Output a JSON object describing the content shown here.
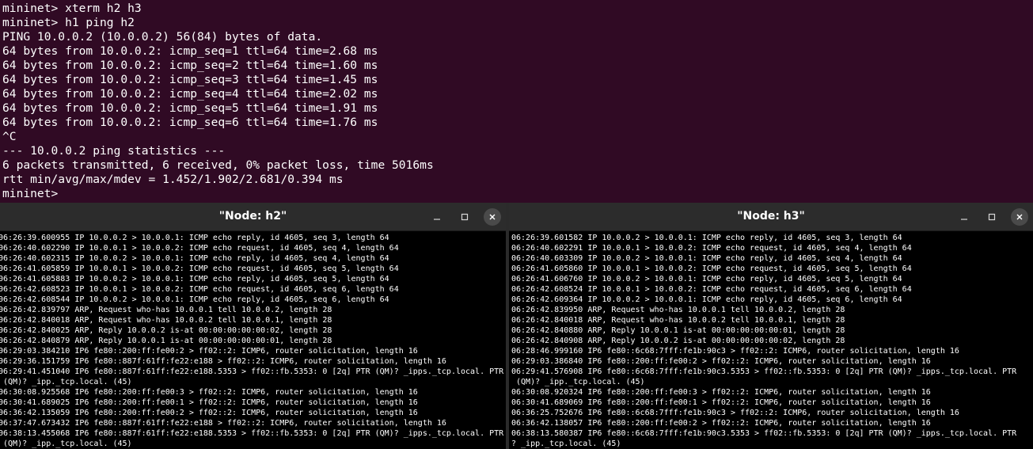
{
  "main_terminal": {
    "lines": [
      "mininet> xterm h2 h3",
      "mininet> h1 ping h2",
      "PING 10.0.0.2 (10.0.0.2) 56(84) bytes of data.",
      "64 bytes from 10.0.0.2: icmp_seq=1 ttl=64 time=2.68 ms",
      "64 bytes from 10.0.0.2: icmp_seq=2 ttl=64 time=1.60 ms",
      "64 bytes from 10.0.0.2: icmp_seq=3 ttl=64 time=1.45 ms",
      "64 bytes from 10.0.0.2: icmp_seq=4 ttl=64 time=2.02 ms",
      "64 bytes from 10.0.0.2: icmp_seq=5 ttl=64 time=1.91 ms",
      "64 bytes from 10.0.0.2: icmp_seq=6 ttl=64 time=1.76 ms",
      "^C",
      "--- 10.0.0.2 ping statistics ---",
      "6 packets transmitted, 6 received, 0% packet loss, time 5016ms",
      "rtt min/avg/max/mdev = 1.452/1.902/2.681/0.394 ms",
      "mininet>"
    ]
  },
  "window_h2": {
    "title": "\"Node: h2\"",
    "minimize_glyph": "–",
    "lines": [
      "06:26:39.600955 IP 10.0.0.2 > 10.0.0.1: ICMP echo reply, id 4605, seq 3, length 64",
      "06:26:40.602290 IP 10.0.0.1 > 10.0.0.2: ICMP echo request, id 4605, seq 4, length 64",
      "06:26:40.602315 IP 10.0.0.2 > 10.0.0.1: ICMP echo reply, id 4605, seq 4, length 64",
      "06:26:41.605859 IP 10.0.0.1 > 10.0.0.2: ICMP echo request, id 4605, seq 5, length 64",
      "06:26:41.605883 IP 10.0.0.2 > 10.0.0.1: ICMP echo reply, id 4605, seq 5, length 64",
      "06:26:42.608523 IP 10.0.0.1 > 10.0.0.2: ICMP echo request, id 4605, seq 6, length 64",
      "06:26:42.608544 IP 10.0.0.2 > 10.0.0.1: ICMP echo reply, id 4605, seq 6, length 64",
      "06:26:42.839797 ARP, Request who-has 10.0.0.1 tell 10.0.0.2, length 28",
      "06:26:42.840018 ARP, Request who-has 10.0.0.2 tell 10.0.0.1, length 28",
      "06:26:42.840025 ARP, Reply 10.0.0.2 is-at 00:00:00:00:00:02, length 28",
      "06:26:42.840879 ARP, Reply 10.0.0.1 is-at 00:00:00:00:00:01, length 28",
      "06:29:03.384210 IP6 fe80::200:ff:fe00:2 > ff02::2: ICMP6, router solicitation, length 16",
      "06:29:36.151759 IP6 fe80::887f:61ff:fe22:e188 > ff02::2: ICMP6, router solicitation, length 16",
      "06:29:41.451040 IP6 fe80::887f:61ff:fe22:e188.5353 > ff02::fb.5353: 0 [2q] PTR (QM)? _ipps._tcp.local. PTR",
      " (QM)? _ipp._tcp.local. (45)",
      "06:30:08.925568 IP6 fe80::200:ff:fe00:3 > ff02::2: ICMP6, router solicitation, length 16",
      "06:30:41.689025 IP6 fe80::200:ff:fe00:1 > ff02::2: ICMP6, router solicitation, length 16",
      "06:36:42.135059 IP6 fe80::200:ff:fe00:2 > ff02::2: ICMP6, router solicitation, length 16",
      "06:37:47.673432 IP6 fe80::887f:61ff:fe22:e188 > ff02::2: ICMP6, router solicitation, length 16",
      "06:38:13.455068 IP6 fe80::887f:61ff:fe22:e188.5353 > ff02::fb.5353: 0 [2q] PTR (QM)? _ipps._tcp.local. PTR",
      " (QM)? _ipp._tcp.local. (45)"
    ]
  },
  "window_h3": {
    "title": "\"Node: h3\"",
    "minimize_glyph": "–",
    "lines": [
      "06:26:39.601582 IP 10.0.0.2 > 10.0.0.1: ICMP echo reply, id 4605, seq 3, length 64",
      "06:26:40.602291 IP 10.0.0.1 > 10.0.0.2: ICMP echo request, id 4605, seq 4, length 64",
      "06:26:40.603309 IP 10.0.0.2 > 10.0.0.1: ICMP echo reply, id 4605, seq 4, length 64",
      "06:26:41.605860 IP 10.0.0.1 > 10.0.0.2: ICMP echo request, id 4605, seq 5, length 64",
      "06:26:41.606760 IP 10.0.0.2 > 10.0.0.1: ICMP echo reply, id 4605, seq 5, length 64",
      "06:26:42.608524 IP 10.0.0.1 > 10.0.0.2: ICMP echo request, id 4605, seq 6, length 64",
      "06:26:42.609364 IP 10.0.0.2 > 10.0.0.1: ICMP echo reply, id 4605, seq 6, length 64",
      "06:26:42.839950 ARP, Request who-has 10.0.0.1 tell 10.0.0.2, length 28",
      "06:26:42.840018 ARP, Request who-has 10.0.0.2 tell 10.0.0.1, length 28",
      "06:26:42.840880 ARP, Reply 10.0.0.1 is-at 00:00:00:00:00:01, length 28",
      "06:26:42.840908 ARP, Reply 10.0.0.2 is-at 00:00:00:00:00:02, length 28",
      "06:28:46.999160 IP6 fe80::6c68:7fff:fe1b:90c3 > ff02::2: ICMP6, router solicitation, length 16",
      "06:29:03.386840 IP6 fe80::200:ff:fe00:2 > ff02::2: ICMP6, router solicitation, length 16",
      "06:29:41.576908 IP6 fe80::6c68:7fff:fe1b:90c3.5353 > ff02::fb.5353: 0 [2q] PTR (QM)? _ipps._tcp.local. PTR",
      " (QM)? _ipp._tcp.local. (45)",
      "06:30:08.920324 IP6 fe80::200:ff:fe00:3 > ff02::2: ICMP6, router solicitation, length 16",
      "06:30:41.689069 IP6 fe80::200:ff:fe00:1 > ff02::2: ICMP6, router solicitation, length 16",
      "06:36:25.752676 IP6 fe80::6c68:7fff:fe1b:90c3 > ff02::2: ICMP6, router solicitation, length 16",
      "06:36:42.138057 IP6 fe80::200:ff:fe00:2 > ff02::2: ICMP6, router solicitation, length 16",
      "06:38:13.580387 IP6 fe80::6c68:7fff:fe1b:90c3.5353 > ff02::fb.5353: 0 [2q] PTR (QM)? _ipps._tcp.local. PTR",
      "? _ipp._tcp.local. (45)"
    ]
  },
  "colors": {
    "terminal_background": "#300a24",
    "xterm_background": "#000000",
    "titlebar_background": "#2c2c2c",
    "text": "#ffffff"
  },
  "icons": {
    "minimize": "minimize-icon",
    "maximize": "maximize-icon",
    "close": "close-icon"
  }
}
